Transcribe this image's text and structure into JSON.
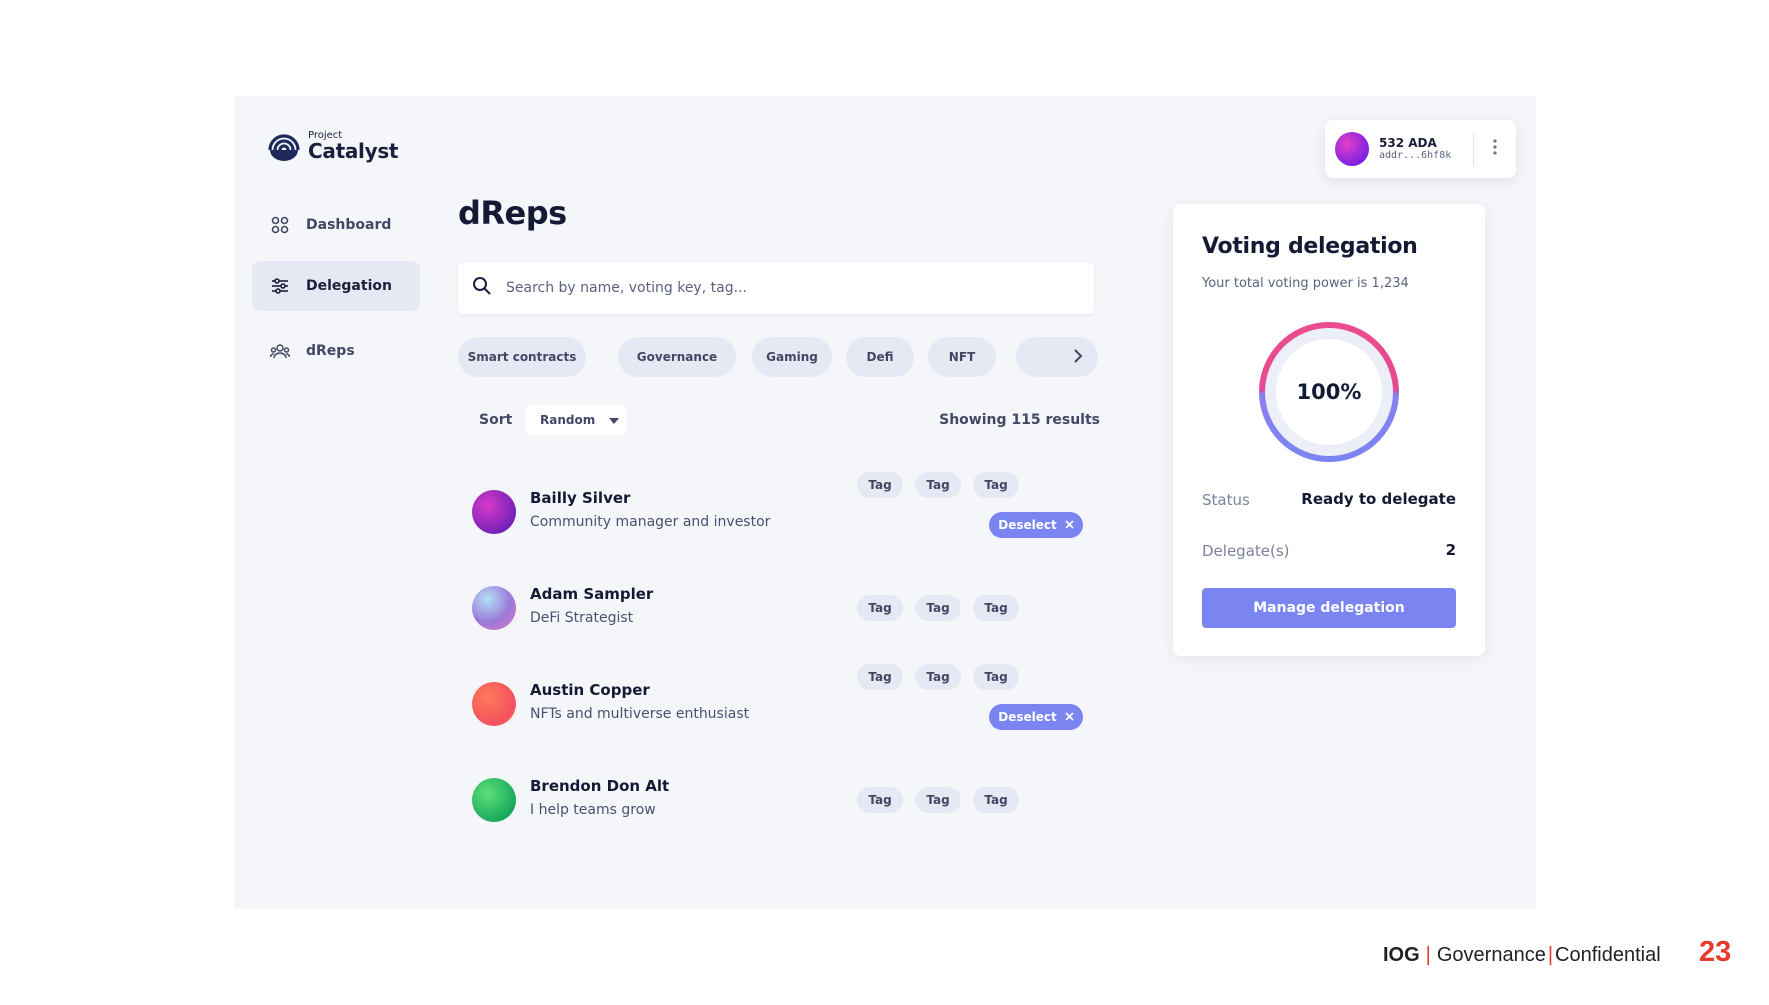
{
  "app": {
    "logo_small": "Project",
    "logo_big": "Catalyst"
  },
  "sidebar": {
    "items": [
      {
        "label": "Dashboard",
        "icon": "grid-icon",
        "active": false
      },
      {
        "label": "Delegation",
        "icon": "sliders-icon",
        "active": true
      },
      {
        "label": "dReps",
        "icon": "users-icon",
        "active": false
      }
    ]
  },
  "main": {
    "title": "dReps",
    "search_placeholder": "Search by name, voting key, tag...",
    "chips": [
      "Smart contracts",
      "Governance",
      "Gaming",
      "Defi",
      "NFT"
    ],
    "sort_label": "Sort",
    "sort_value": "Random",
    "results_text": "Showing 115 results",
    "dreps": [
      {
        "name": "Bailly Silver",
        "description": "Community manager and investor",
        "tags": [
          "Tag",
          "Tag",
          "Tag"
        ],
        "selected": true,
        "deselect_label": "Deselect"
      },
      {
        "name": "Adam Sampler",
        "description": "DeFi Strategist",
        "tags": [
          "Tag",
          "Tag",
          "Tag"
        ],
        "selected": false
      },
      {
        "name": "Austin Copper",
        "description": "NFTs and multiverse enthusiast",
        "tags": [
          "Tag",
          "Tag",
          "Tag"
        ],
        "selected": true,
        "deselect_label": "Deselect"
      },
      {
        "name": "Brendon Don Alt",
        "description": "I help teams grow",
        "tags": [
          "Tag",
          "Tag",
          "Tag"
        ],
        "selected": false
      }
    ]
  },
  "wallet": {
    "balance": "532 ADA",
    "address": "addr...6hf8k"
  },
  "delegation": {
    "title": "Voting delegation",
    "subtitle": "Your total voting power is 1,234",
    "percent_label": "100%",
    "percent_value": 100,
    "status_label": "Status",
    "status_value": "Ready to delegate",
    "delegates_label": "Delegate(s)",
    "delegates_value": "2",
    "button_label": "Manage delegation"
  },
  "footer": {
    "brand": "IOG",
    "sep": "|",
    "part1": "Governance",
    "part2": "Confidential",
    "page_number": "23"
  },
  "colors": {
    "accent": "#7b85f2",
    "ring_blue": "#7b85f2",
    "ring_pink": "#ea4c8f",
    "footer_red": "#e63a2e"
  }
}
